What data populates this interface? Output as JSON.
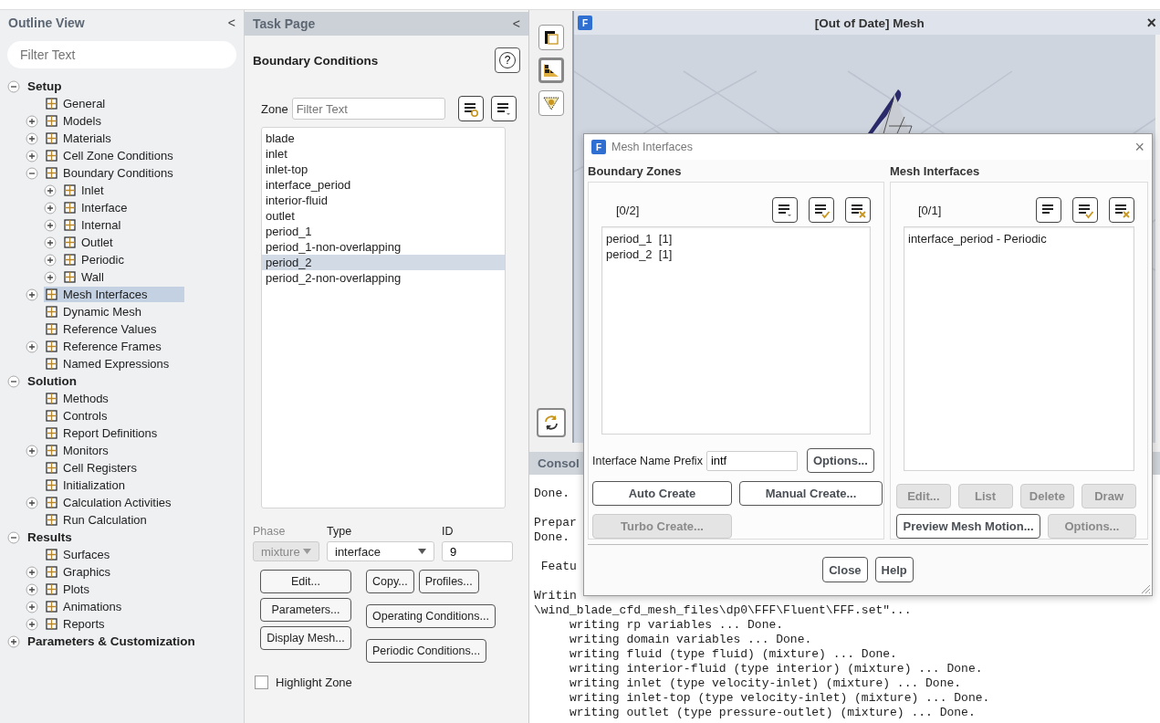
{
  "outline": {
    "title": "Outline View",
    "collapse": "<",
    "filter": {
      "placeholder": "Filter Text"
    },
    "tree": [
      {
        "label": "Setup",
        "expanded": true,
        "selected": false,
        "children": [
          {
            "label": "General",
            "selected": false
          },
          {
            "label": "Models",
            "expanded": false,
            "selected": false
          },
          {
            "label": "Materials",
            "expanded": false,
            "selected": false
          },
          {
            "label": "Cell Zone Conditions",
            "expanded": false,
            "selected": false
          },
          {
            "label": "Boundary Conditions",
            "expanded": true,
            "selected": false,
            "children": [
              {
                "label": "Inlet",
                "expanded": false,
                "selected": false
              },
              {
                "label": "Interface",
                "expanded": false,
                "selected": false
              },
              {
                "label": "Internal",
                "expanded": false,
                "selected": false
              },
              {
                "label": "Outlet",
                "expanded": false,
                "selected": false
              },
              {
                "label": "Periodic",
                "expanded": false,
                "selected": false
              },
              {
                "label": "Wall",
                "expanded": false,
                "selected": false
              }
            ]
          },
          {
            "label": "Mesh Interfaces",
            "expanded": false,
            "selected": true
          },
          {
            "label": "Dynamic Mesh",
            "selected": false
          },
          {
            "label": "Reference Values",
            "selected": false
          },
          {
            "label": "Reference Frames",
            "expanded": false,
            "selected": false
          },
          {
            "label": "Named Expressions",
            "selected": false
          }
        ]
      },
      {
        "label": "Solution",
        "expanded": true,
        "selected": false,
        "children": [
          {
            "label": "Methods",
            "selected": false
          },
          {
            "label": "Controls",
            "selected": false
          },
          {
            "label": "Report Definitions",
            "selected": false
          },
          {
            "label": "Monitors",
            "expanded": false,
            "selected": false
          },
          {
            "label": "Cell Registers",
            "selected": false
          },
          {
            "label": "Initialization",
            "selected": false
          },
          {
            "label": "Calculation Activities",
            "expanded": false,
            "selected": false
          },
          {
            "label": "Run Calculation",
            "selected": false
          }
        ]
      },
      {
        "label": "Results",
        "expanded": true,
        "selected": false,
        "children": [
          {
            "label": "Surfaces",
            "selected": false
          },
          {
            "label": "Graphics",
            "expanded": false,
            "selected": false
          },
          {
            "label": "Plots",
            "expanded": false,
            "selected": false
          },
          {
            "label": "Animations",
            "expanded": false,
            "selected": false
          },
          {
            "label": "Reports",
            "expanded": false,
            "selected": false
          }
        ]
      },
      {
        "label": "Parameters & Customization",
        "expanded": false,
        "selected": false
      }
    ]
  },
  "task_page": {
    "title": "Task Page",
    "collapse": "<",
    "heading": "Boundary Conditions",
    "help": "?",
    "zone_label": "Zone",
    "zone_filter": {
      "placeholder": "Filter Text"
    },
    "zones": [
      {
        "label": "blade",
        "selected": false
      },
      {
        "label": "inlet",
        "selected": false
      },
      {
        "label": "inlet-top",
        "selected": false
      },
      {
        "label": "interface_period",
        "selected": false
      },
      {
        "label": "interior-fluid",
        "selected": false
      },
      {
        "label": "outlet",
        "selected": false
      },
      {
        "label": "period_1",
        "selected": false
      },
      {
        "label": "period_1-non-overlapping",
        "selected": false
      },
      {
        "label": "period_2",
        "selected": true
      },
      {
        "label": "period_2-non-overlapping",
        "selected": false
      }
    ],
    "phase": {
      "label": "Phase",
      "value": "mixture",
      "disabled": true
    },
    "type": {
      "label": "Type",
      "value": "interface",
      "disabled": false
    },
    "id": {
      "label": "ID",
      "value": "9"
    },
    "buttons_left": [
      "Edit...",
      "Parameters...",
      "Display Mesh..."
    ],
    "buttons_right": [
      [
        "Copy...",
        "Profiles..."
      ],
      [
        "Operating Conditions..."
      ],
      [
        "Periodic Conditions..."
      ]
    ],
    "highlight_zone": {
      "label": "Highlight Zone",
      "checked": false
    }
  },
  "graphics": {
    "logo": "F",
    "title": "[Out of Date] Mesh",
    "close": "×"
  },
  "console": {
    "title": "Consol",
    "blocks": [
      [
        "Done."
      ],
      [
        "Prepar",
        "Done."
      ],
      [
        " Featu"
      ],
      [
        "Writin",
        "\\wind_blade_cfd_mesh_files\\dp0\\FFF\\Fluent\\FFF.set\"...",
        "     writing rp variables ... Done.",
        "     writing domain variables ... Done.",
        "     writing fluid (type fluid) (mixture) ... Done.",
        "     writing interior-fluid (type interior) (mixture) ... Done.",
        "     writing inlet (type velocity-inlet) (mixture) ... Done.",
        "     writing inlet-top (type velocity-inlet) (mixture) ... Done.",
        "     writing outlet (type pressure-outlet) (mixture) ... Done."
      ]
    ]
  },
  "dialog": {
    "logo": "F",
    "title": "Mesh Interfaces",
    "close": "×",
    "boundary_zones": {
      "title": "Boundary Zones",
      "count": "[0/2]",
      "items": [
        {
          "label": "period_1  [1]",
          "selected": false
        },
        {
          "label": "period_2  [1]",
          "selected": false
        }
      ],
      "prefix": {
        "label": "Interface Name Prefix",
        "value": "intf"
      },
      "options_button": {
        "label": "Options...",
        "disabled": false
      },
      "create_buttons": [
        {
          "label": "Auto Create",
          "disabled": false
        },
        {
          "label": "Manual Create...",
          "disabled": false
        },
        {
          "label": "Turbo Create...",
          "disabled": true
        }
      ]
    },
    "mesh_interfaces": {
      "title": "Mesh Interfaces",
      "count": "[0/1]",
      "items": [
        {
          "label": "interface_period - Periodic",
          "selected": false
        }
      ],
      "actions": [
        {
          "label": "Edit...",
          "disabled": true
        },
        {
          "label": "List",
          "disabled": true
        },
        {
          "label": "Delete",
          "disabled": true
        },
        {
          "label": "Draw",
          "disabled": true
        }
      ],
      "motion_buttons": [
        {
          "label": "Preview Mesh Motion...",
          "disabled": false
        },
        {
          "label": "Options...",
          "disabled": true
        }
      ]
    },
    "buttons": [
      {
        "label": "Close",
        "disabled": false
      },
      {
        "label": "Help",
        "disabled": false
      }
    ]
  }
}
